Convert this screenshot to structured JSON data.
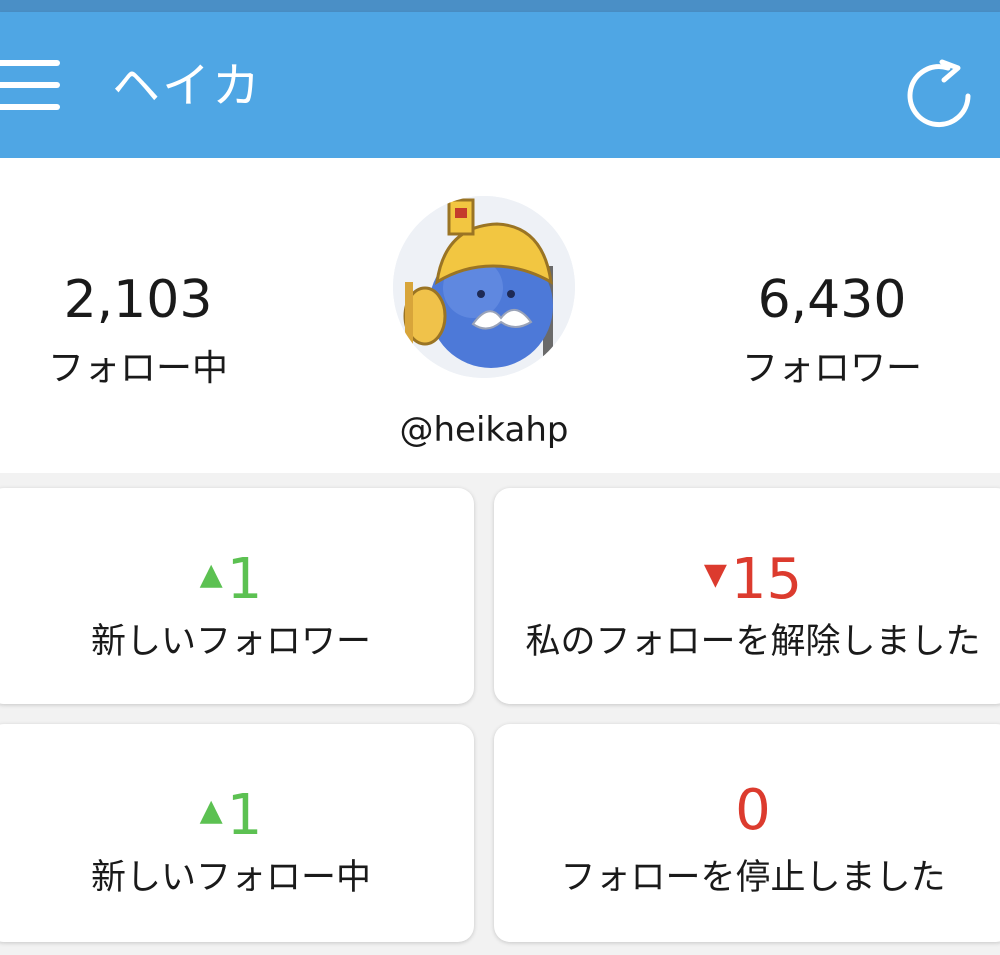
{
  "app_bar": {
    "title": "ヘイカ",
    "menu_icon": "hamburger-menu-icon",
    "refresh_icon": "refresh-icon",
    "color": "#4fa6e4"
  },
  "profile": {
    "following_count": "2,103",
    "following_label": "フォロー中",
    "followers_count": "6,430",
    "followers_label": "フォロワー",
    "handle": "@heikahp"
  },
  "cards": [
    {
      "value": "1",
      "trend": "up",
      "trend_symbol": "▲",
      "label": "新しいフォロワー",
      "color": "#5cc152"
    },
    {
      "value": "15",
      "trend": "down",
      "trend_symbol": "▼",
      "label": "私のフォローを解除しました",
      "color": "#dc3b2e"
    },
    {
      "value": "1",
      "trend": "up",
      "trend_symbol": "▲",
      "label": "新しいフォロー中",
      "color": "#5cc152"
    },
    {
      "value": "0",
      "trend": "none",
      "label": "フォローを停止しました",
      "color": "#dc3b2e"
    }
  ]
}
